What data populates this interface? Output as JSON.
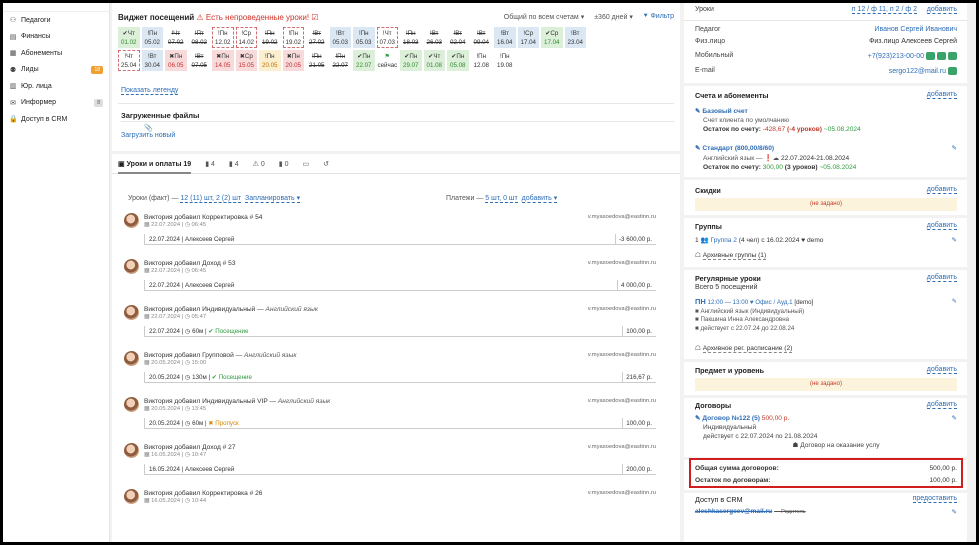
{
  "sidebar": {
    "items": [
      {
        "label": "Педагоги",
        "icon": "teacher-icon",
        "glyph": "⚇"
      },
      {
        "label": "Финансы",
        "icon": "finance-icon",
        "glyph": "▤"
      },
      {
        "label": "Абонементы",
        "icon": "subscription-icon",
        "glyph": "▦"
      },
      {
        "label": "Лиды",
        "icon": "leads-icon",
        "glyph": "⚉",
        "badge": "18"
      },
      {
        "label": "Юр. лица",
        "icon": "legal-entity-icon",
        "glyph": "▥"
      },
      {
        "label": "Информер",
        "icon": "informer-icon",
        "glyph": "✉",
        "badge": "8"
      },
      {
        "label": "Доступ в CRM",
        "icon": "lock-icon",
        "glyph": "🔒"
      }
    ]
  },
  "widget": {
    "title": "Виджет посещений",
    "warning": "Есть непроведенные уроки!",
    "scope": "Общий по всем счетам",
    "period": "±360 дней",
    "filter": "Фильтр",
    "legend_link": "Показать легенду",
    "days": [
      [
        {
          "w": "Чт",
          "d": "01.02",
          "c": "g"
        },
        {
          "w": "Пн",
          "d": "05.02",
          "c": "b"
        },
        {
          "w": "Чт",
          "d": "07.02",
          "c": "w",
          "s": 1
        },
        {
          "w": "Пт",
          "d": "08.02",
          "c": "w",
          "s": 1
        },
        {
          "w": "Пн",
          "d": "12.02",
          "c": "w",
          "x": 1
        },
        {
          "w": "Ср",
          "d": "14.02",
          "c": "w",
          "x": 1
        },
        {
          "w": "Пн",
          "d": "19.02",
          "c": "w",
          "s": 1
        },
        {
          "w": "Пн",
          "d": "19.02",
          "c": "w",
          "x": 1
        },
        {
          "w": "Вт",
          "d": "27.02",
          "c": "w",
          "s": 1
        },
        {
          "w": "Вт",
          "d": "05.03",
          "c": "b"
        },
        {
          "w": "Пн",
          "d": "05.03",
          "c": "b"
        },
        {
          "w": "Чт",
          "d": "07.03",
          "c": "w",
          "x": 1
        },
        {
          "w": "Пн",
          "d": "18.03",
          "c": "w",
          "s": 1
        },
        {
          "w": "Вт",
          "d": "26.03",
          "c": "w",
          "s": 1
        },
        {
          "w": "Вт",
          "d": "02.04",
          "c": "w",
          "s": 1
        },
        {
          "w": "Вт",
          "d": "09.04",
          "c": "w",
          "s": 1
        },
        {
          "w": "Вт",
          "d": "16.04",
          "c": "b"
        },
        {
          "w": "Ср",
          "d": "17.04",
          "c": "b"
        },
        {
          "w": "Ср",
          "d": "17.04",
          "c": "g"
        },
        {
          "w": "Вт",
          "d": "23.04",
          "c": "b"
        }
      ],
      [
        {
          "w": "Чт",
          "d": "25.04",
          "c": "w",
          "x": 1
        },
        {
          "w": "Вт",
          "d": "30.04",
          "c": "b"
        },
        {
          "w": "Пн",
          "d": "06.05",
          "c": "r"
        },
        {
          "w": "Вт",
          "d": "07.05",
          "c": "w",
          "s": 1
        },
        {
          "w": "Пн",
          "d": "14.05",
          "c": "r"
        },
        {
          "w": "Ср",
          "d": "15.05",
          "c": "r"
        },
        {
          "w": "Пн",
          "d": "20.05",
          "c": "y"
        },
        {
          "w": "Пн",
          "d": "20.05",
          "c": "r"
        },
        {
          "w": "Пн",
          "d": "21.05",
          "c": "w",
          "s": 1
        },
        {
          "w": "Пн",
          "d": "22.07",
          "c": "w",
          "s": 1
        },
        {
          "w": "Пн",
          "d": "22.07",
          "c": "g"
        },
        {
          "w": "",
          "d": "сейчас",
          "c": "w",
          "now": 1
        },
        {
          "w": "Пн",
          "d": "29.07",
          "c": "g"
        },
        {
          "w": "Чт",
          "d": "01.08",
          "c": "g"
        },
        {
          "w": "Пн",
          "d": "05.08",
          "c": "g"
        },
        {
          "w": "Пн",
          "d": "12.08",
          "c": "w"
        },
        {
          "w": "Пн",
          "d": "19.08",
          "c": "w"
        }
      ]
    ]
  },
  "files": {
    "title": "Загруженные файлы",
    "upload": "Загрузить новый"
  },
  "tabs": [
    {
      "label": "Уроки и оплаты 19",
      "active": true
    },
    {
      "label": "4"
    },
    {
      "label": "4"
    },
    {
      "label": "0"
    },
    {
      "label": "0"
    },
    {
      "label": ""
    },
    {
      "label": ""
    }
  ],
  "lessons_bar": {
    "lessons": "Уроки (факт) —",
    "lessons_link": "12 (11) шт, 2 (2) шт",
    "plan": "Запланировать",
    "payments": "Платежи —",
    "pay_link": "5 шт, 0 шт",
    "add": "добавить"
  },
  "feed": [
    {
      "author": "Виктория добавил",
      "title": "Корректировка # 54",
      "sub": "",
      "date": "22.07.2024",
      "time": "06:45",
      "email": "v.myasoedova@eastinn.ru",
      "ldate": "22.07.2024",
      "person": "Алексеев Сергей",
      "dur": "",
      "status": "",
      "st": "",
      "amount": "-3 600,00 р."
    },
    {
      "author": "Виктория добавил",
      "title": "Доход # 53",
      "sub": "",
      "date": "22.07.2024",
      "time": "06:45",
      "email": "v.myasoedova@eastinn.ru",
      "ldate": "22.07.2024",
      "person": "Алексеев Сергей",
      "dur": "",
      "status": "",
      "st": "",
      "amount": "4 000,00 р."
    },
    {
      "author": "Виктория добавил",
      "title": "Индивидуальный",
      "sub": "— Английский язык",
      "date": "22.07.2024",
      "time": "05:47",
      "email": "v.myasoedova@eastinn.ru",
      "ldate": "22.07.2024",
      "person": "",
      "dur": "60м",
      "status": "✔ Посещение",
      "st": "ok",
      "amount": "100,00 р."
    },
    {
      "author": "Виктория добавил",
      "title": "Групповой",
      "sub": "— Английский язык",
      "date": "20.05.2024",
      "time": "15:00",
      "email": "v.myasoedova@eastinn.ru",
      "ldate": "20.05.2024",
      "person": "",
      "dur": "130м",
      "status": "✔ Посещение",
      "st": "ok",
      "amount": "216,67 р."
    },
    {
      "author": "Виктория добавил",
      "title": "Индивидуальный VIP",
      "sub": "— Английский язык",
      "date": "20.05.2024",
      "time": "13:45",
      "email": "v.myasoedova@eastinn.ru",
      "ldate": "20.05.2024",
      "person": "",
      "dur": "60м",
      "status": "✖ Пропуск",
      "st": "miss",
      "amount": "100,00 р."
    },
    {
      "author": "Виктория добавил",
      "title": "Доход # 27",
      "sub": "",
      "date": "16.05.2024",
      "time": "10:47",
      "email": "v.myasoedova@eastinn.ru",
      "ldate": "16.05.2024",
      "person": "Алексеев Сергей",
      "dur": "",
      "status": "",
      "st": "",
      "amount": "200,00 р."
    },
    {
      "author": "Виктория добавил",
      "title": "Корректировка # 26",
      "sub": "",
      "date": "16.05.2024",
      "time": "10:44",
      "email": "v.myasoedova@eastinn.ru",
      "ldate": "",
      "person": "",
      "dur": "",
      "status": "",
      "st": "",
      "amount": ""
    }
  ],
  "right": {
    "lessons_label": "Уроки",
    "lessons_val": "п 12 / ф 11, п 2 / ф 2",
    "add": "добавить",
    "teacher_l": "Педагог",
    "teacher_v": "Иванов Сергей Иванович",
    "fiz_l": "Физ.лицо",
    "fiz_v": "Физ.лицо Алексеев Сергей",
    "mob_l": "Мобильный",
    "mob_v": "+7(923)213-00-00",
    "email_l": "E-mail",
    "email_v": "sergo122@mail.ru",
    "acc_title": "Счета и абонементы",
    "acc1_name": "Базовый счет",
    "acc1_desc": "Счет клиента по умолчанию",
    "acc1_bal_l": "Остаток по счету:",
    "acc1_bal": "-428,67",
    "acc1_les": "(-4 уроков)",
    "acc1_date": "~05.08.2024",
    "acc2_name": "Стандарт (800,00/8/60)",
    "acc2_desc": "Английский язык — ",
    "acc2_dates": "22.07.2024-21.08.2024",
    "acc2_bal_l": "Остаток по счету:",
    "acc2_bal": "300,00",
    "acc2_les": "(3 уроков)",
    "acc2_date": "~05.08.2024",
    "disc_title": "Скидки",
    "not_set": "(не задано)",
    "groups_title": "Группы",
    "group_line": "Группа 2",
    "group_rest": "(4 чел) с 16.02.2024",
    "group_tag": "demo",
    "archive_groups": "Архивные группы (1)",
    "reg_title": "Регулярные уроки",
    "reg_sub": "Всего 5 посещений",
    "reg_day": "ПН",
    "reg_time": "12:00 — 13:00",
    "reg_room": "Офис / Ауд.1",
    "reg_tag": "[demo]",
    "reg_subj": "Английский язык (Индивидуальный)",
    "reg_teacher": "Пакшина Инна Александровна",
    "reg_dates": "действует с 22.07.24 до 22.08.24",
    "reg_archive": "Архивное рег. расписание (2)",
    "subj_title": "Предмет и уровень",
    "contract_title": "Договоры",
    "contract_name": "Договор №122 (5)",
    "contract_sum": "500,00 р.",
    "contract_type": "Индивидуальный",
    "contract_dates": "действует с 22.07.2024 по 21.08.2024",
    "contract_service": "Договор на оказание услу",
    "total_l": "Общая сумма договоров:",
    "total_v": "500,00 р.",
    "rest_l": "Остаток по договорам:",
    "rest_v": "100,00 р.",
    "crm_title": "Доступ в CRM",
    "crm_link": "предоставить",
    "crm_email": "aleshkasergeev@mail.ru",
    "crm_role": "— Родитель"
  }
}
